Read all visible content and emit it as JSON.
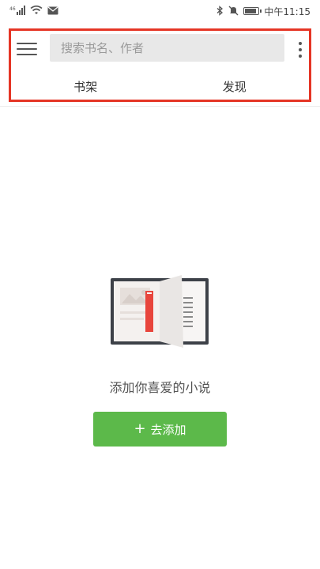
{
  "status_bar": {
    "time": "中午11:15",
    "battery_level": 0.9
  },
  "toolbar": {
    "search_placeholder": "搜索书名、作者",
    "tabs": [
      {
        "label": "书架"
      },
      {
        "label": "发现"
      }
    ]
  },
  "empty_state": {
    "message": "添加你喜爱的小说",
    "add_button_label": "去添加",
    "add_button_icon": "+"
  },
  "colors": {
    "accent_green": "#5cb94a",
    "highlight_red": "#e53525",
    "bookmark_red": "#e8453c"
  }
}
